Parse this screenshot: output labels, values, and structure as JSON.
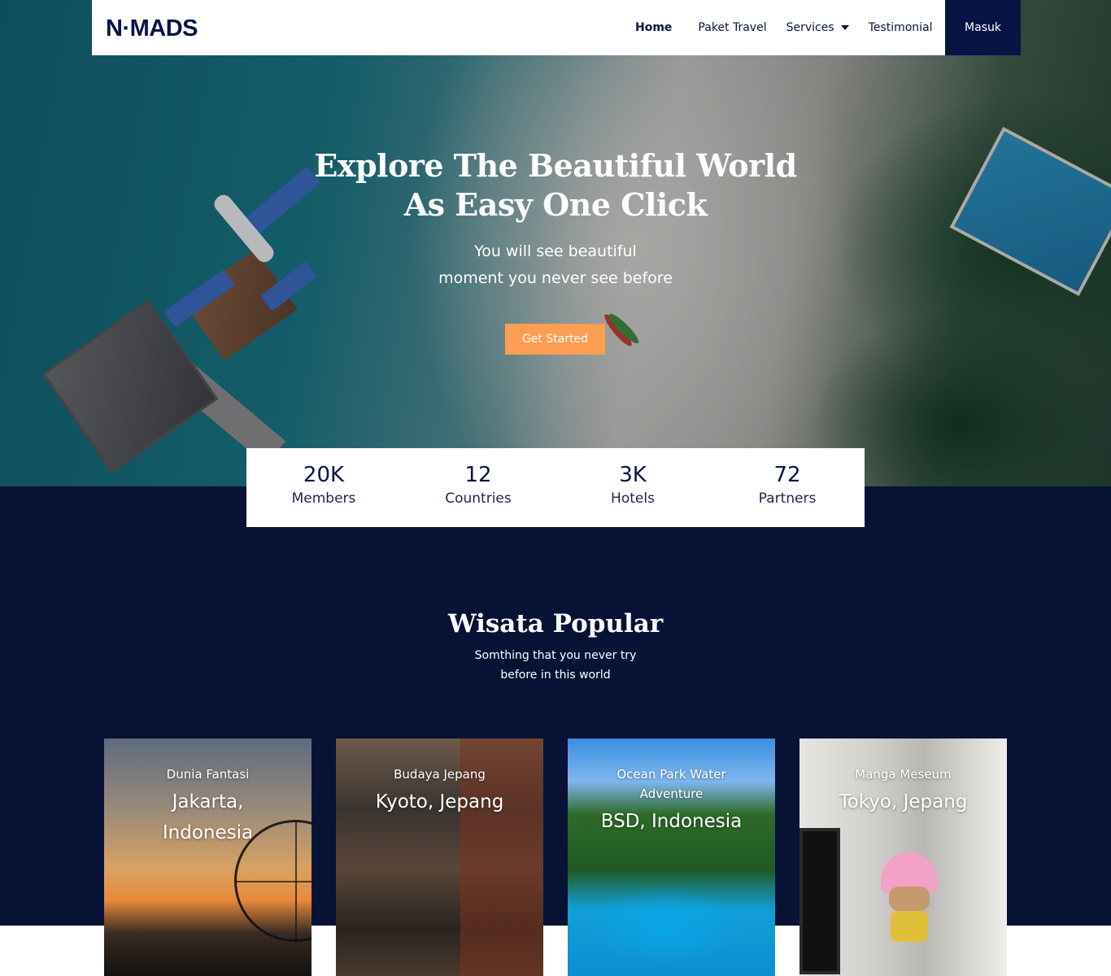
{
  "nav": {
    "logo": "N·MADS",
    "links": [
      {
        "label": "Home",
        "active": true
      },
      {
        "label": "Paket Travel"
      },
      {
        "label": "Services",
        "dropdown": true
      },
      {
        "label": "Testimonial"
      }
    ],
    "login_label": "Masuk"
  },
  "hero": {
    "title_line1": "Explore The Beautiful World",
    "title_line2": "As Easy One Click",
    "subtitle_line1": "You will see beautiful",
    "subtitle_line2": "moment you never see before",
    "cta_label": "Get Started"
  },
  "stats": [
    {
      "value": "20K",
      "label": "Members"
    },
    {
      "value": "12",
      "label": "Countries"
    },
    {
      "value": "3K",
      "label": "Hotels"
    },
    {
      "value": "72",
      "label": "Partners"
    }
  ],
  "popular": {
    "title": "Wisata Popular",
    "subtitle_line1": "Somthing that you never try",
    "subtitle_line2": "before in this world",
    "cards": [
      {
        "category": "Dunia Fantasi",
        "location": "Jakarta, Indonesia"
      },
      {
        "category": "Budaya Jepang",
        "location": "Kyoto, Jepang"
      },
      {
        "category": "Ocean Park Water Adventure",
        "location": "BSD, Indonesia"
      },
      {
        "category": "Manga Meseum",
        "location": "Tokyo, Jepang"
      }
    ]
  },
  "colors": {
    "navy": "#071446",
    "dark_section": "#071235",
    "accent": "#ff9e53"
  }
}
